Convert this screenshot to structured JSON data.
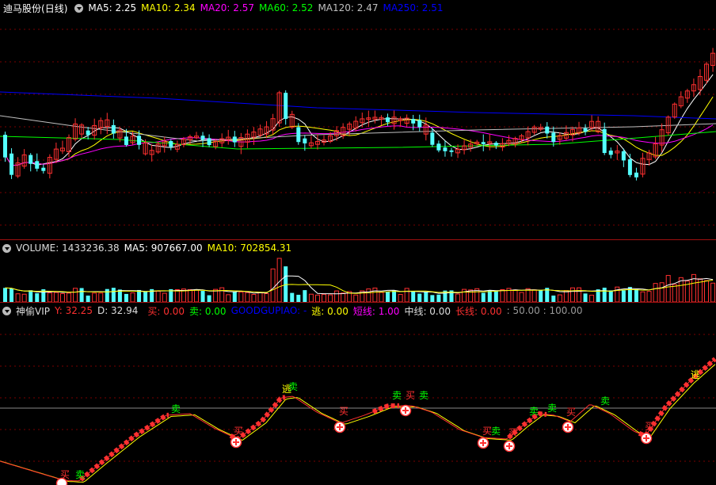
{
  "price_panel": {
    "stock_name": "迪马股份",
    "period": "(日线)",
    "indicators": [
      {
        "label": "MA5: 2.25",
        "color": "#ffffff"
      },
      {
        "label": "MA10: 2.34",
        "color": "#ffff00"
      },
      {
        "label": "MA20: 2.57",
        "color": "#ff00ff"
      },
      {
        "label": "MA60: 2.52",
        "color": "#00ff00"
      },
      {
        "label": "MA120: 2.47",
        "color": "#c0c0c0"
      },
      {
        "label": "MA250: 2.51",
        "color": "#0000ff"
      }
    ]
  },
  "volume_panel": {
    "title": "VOLUME: 1433236.38",
    "ma5": "MA5: 907667.00",
    "ma10": "MA10: 702854.31"
  },
  "indicator_panel": {
    "name": "神偷VIP",
    "items": [
      {
        "label": "Y: 32.25",
        "color": "#ff3030"
      },
      {
        "label": "D: 32.94",
        "color": "#dddddd"
      },
      {
        "label": "买: 0.00",
        "color": "#ff3030"
      },
      {
        "label": "卖: 0.00",
        "color": "#00ff00"
      },
      {
        "label": "GOODGUPIAO: -",
        "color": "#0000ff"
      },
      {
        "label": "逃: 0.00",
        "color": "#ffff00"
      },
      {
        "label": "短线: 1.00",
        "color": "#ff00ff"
      },
      {
        "label": "中线: 0.00",
        "color": "#dddddd"
      },
      {
        "label": "长线: 0.00",
        "color": "#ff3030"
      },
      {
        "label": ": 50.00 : 100.00",
        "color": "#999999"
      }
    ],
    "signal_labels": {
      "buy": "买",
      "sell": "卖",
      "escape": "逃"
    }
  },
  "colors": {
    "up": "#ff3030",
    "down": "#54ffff",
    "grid": "#7a0000",
    "separator": "#a01010",
    "ref_line": "#888888"
  }
}
